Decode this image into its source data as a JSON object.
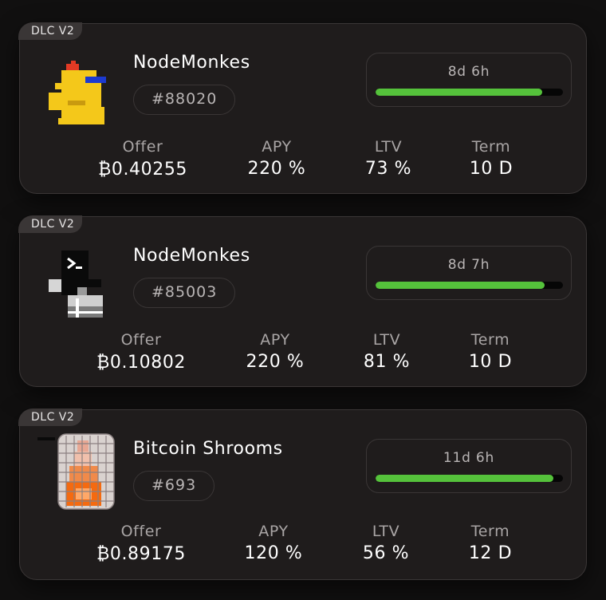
{
  "labels": {
    "offer": "Offer",
    "apy": "APY",
    "ltv": "LTV",
    "term": "Term"
  },
  "cards": [
    {
      "badge": "DLC V2",
      "name": "NodeMonkes",
      "id": "#88020",
      "timer": "8d 6h",
      "progress": 0.89,
      "offer": "₿0.40255",
      "apy": "220 %",
      "ltv": "73 %",
      "term": "10 D",
      "thumbnail": "nodemonke-yellow"
    },
    {
      "badge": "DLC V2",
      "name": "NodeMonkes",
      "id": "#85003",
      "timer": "8d 7h",
      "progress": 0.9,
      "offer": "₿0.10802",
      "apy": "220 %",
      "ltv": "81 %",
      "term": "10 D",
      "thumbnail": "nodemonke-terminal"
    },
    {
      "badge": "DLC V2",
      "name": "Bitcoin Shrooms",
      "id": "#693",
      "timer": "11d 6h",
      "progress": 0.95,
      "offer": "₿0.89175",
      "apy": "120 %",
      "ltv": "56 %",
      "term": "12 D",
      "thumbnail": "bitcoin-shroom"
    }
  ],
  "colors": {
    "progress": "#55c23b",
    "card": "#1f1c1c",
    "border": "#3a3636"
  }
}
